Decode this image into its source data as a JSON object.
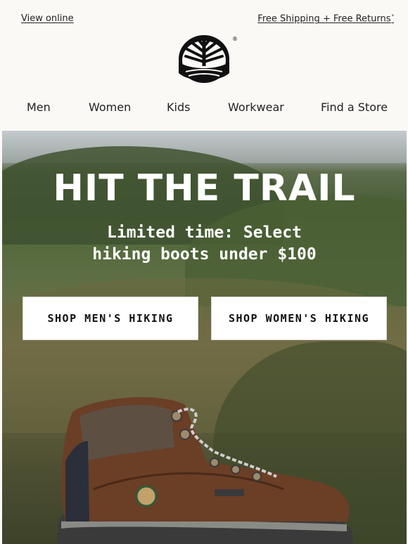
{
  "topbar": {
    "view_online": "View online",
    "shipping": "Free Shipping + Free Returns",
    "shipping_mark": "*"
  },
  "logo": {
    "name": "timberland-tree-logo",
    "registered_mark": "®"
  },
  "nav": {
    "items": [
      {
        "label": "Men"
      },
      {
        "label": "Women"
      },
      {
        "label": "Kids"
      },
      {
        "label": "Workwear"
      },
      {
        "label": "Find a Store"
      }
    ]
  },
  "hero": {
    "headline": "HIT THE TRAIL",
    "subline_1": "Limited time: Select",
    "subline_2": "hiking boots under $100",
    "cta_men": "SHOP MEN'S HIKING",
    "cta_women": "SHOP WOMEN'S HIKING"
  },
  "colors": {
    "background": "#fbf9f6",
    "text": "#1a1a1a",
    "button_bg": "#ffffff",
    "boot_leather": "#6b3e26"
  }
}
